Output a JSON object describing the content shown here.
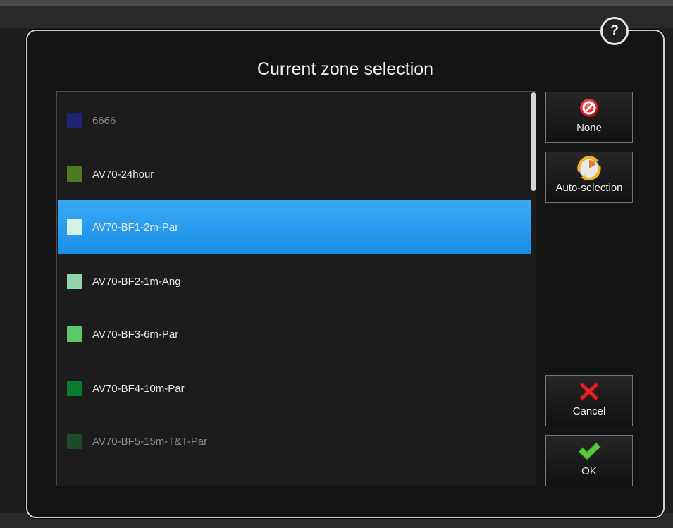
{
  "dialog": {
    "title": "Current zone selection",
    "help_label": "?"
  },
  "zones": [
    {
      "label": "6666",
      "color": "#1e2470",
      "dim": true,
      "selected": false
    },
    {
      "label": "AV70-24hour",
      "color": "#4c7a1c",
      "dim": false,
      "selected": false
    },
    {
      "label": "AV70-BF1-2m-Par",
      "color": "#d6f2e6",
      "dim": false,
      "selected": true
    },
    {
      "label": "AV70-BF2-1m-Ang",
      "color": "#8fd4aa",
      "dim": false,
      "selected": false
    },
    {
      "label": "AV70-BF3-6m-Par",
      "color": "#5ec76a",
      "dim": false,
      "selected": false
    },
    {
      "label": "AV70-BF4-10m-Par",
      "color": "#0c7a2c",
      "dim": false,
      "selected": false
    },
    {
      "label": "AV70-BF5-15m-T&T-Par",
      "color": "#1f4a2a",
      "dim": true,
      "selected": false
    }
  ],
  "buttons": {
    "none": "None",
    "auto": "Auto-selection",
    "cancel": "Cancel",
    "ok": "OK"
  },
  "icons": {
    "none": "no-entry-icon",
    "auto": "auto-selection-icon",
    "cancel": "red-x-icon",
    "ok": "green-check-icon",
    "help": "help-icon"
  }
}
